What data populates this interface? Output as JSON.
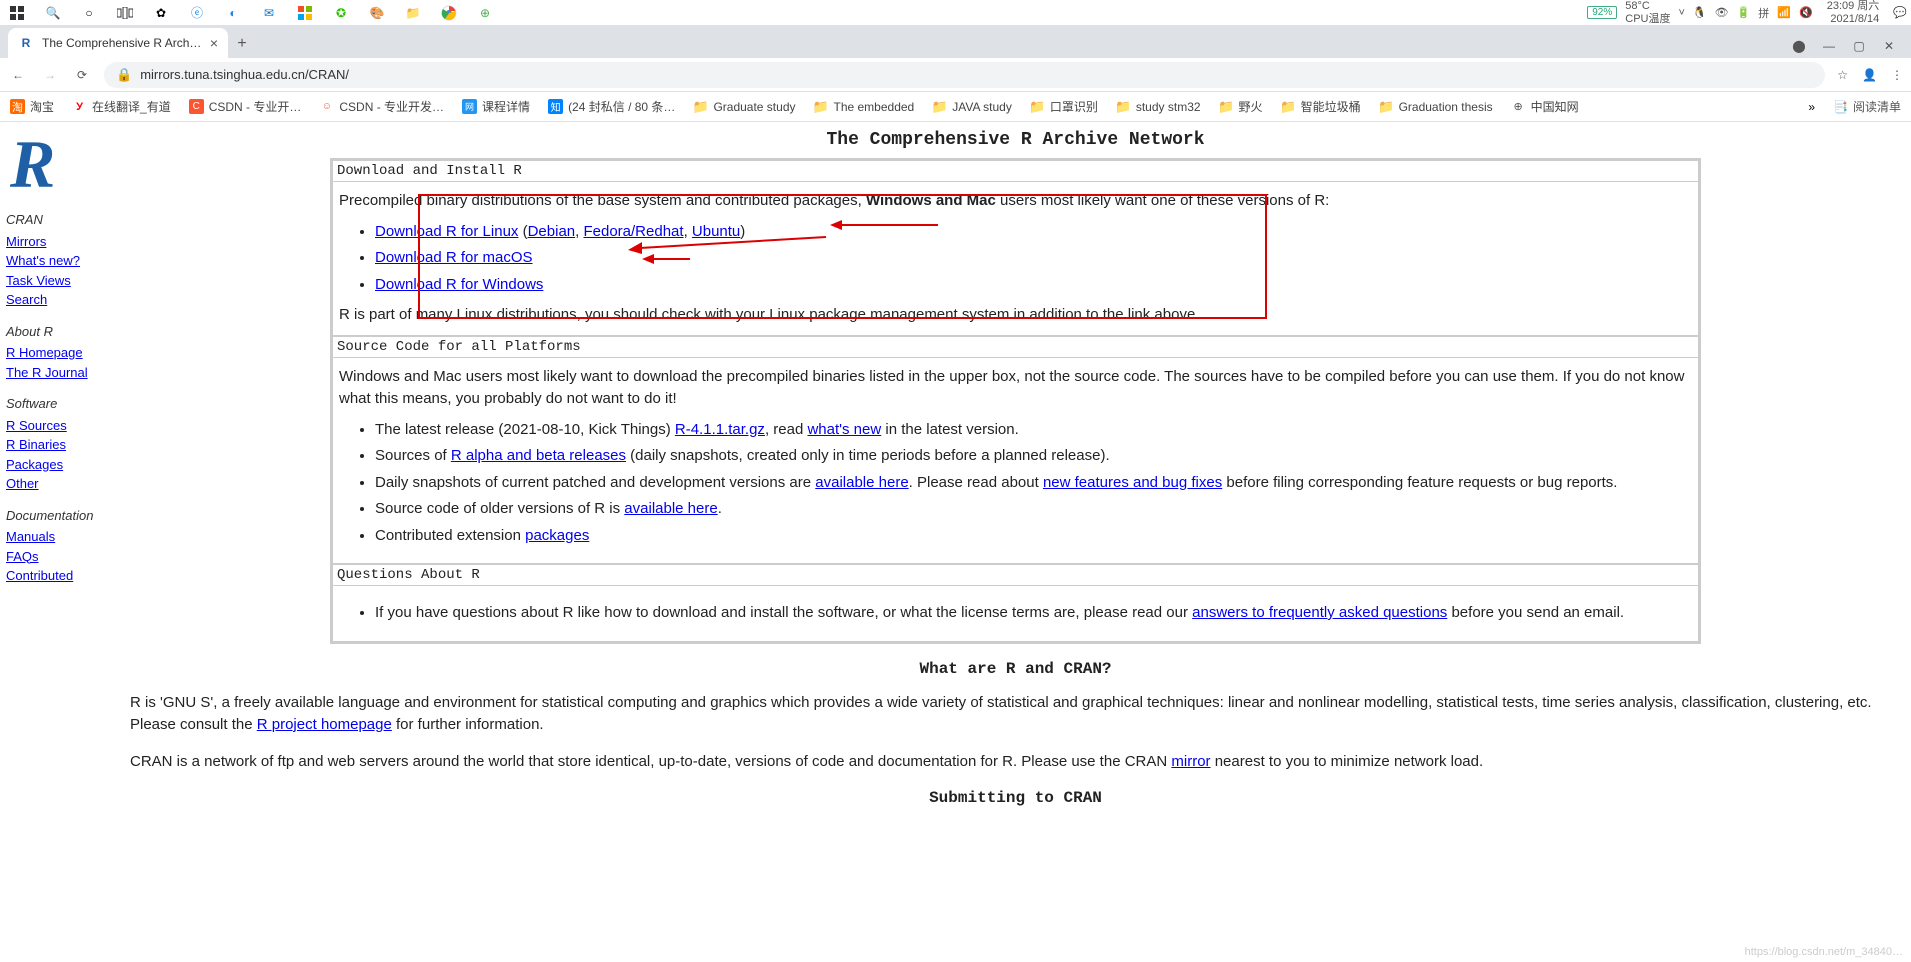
{
  "taskbar": {
    "battery_percent": "92%",
    "cpu_temp": "58°C",
    "cpu_label": "CPU温度",
    "time": "23:09",
    "day": "周六",
    "date": "2021/8/14"
  },
  "browser": {
    "tab_title": "The Comprehensive R Archive…",
    "new_tab": "+",
    "url": "mirrors.tuna.tsinghua.edu.cn/CRAN/",
    "account_icon": "👤",
    "menu_icon": "⋮",
    "star_icon": "☆"
  },
  "bookmarks": {
    "items": [
      {
        "label": "淘宝",
        "icon_class": "bm-taobao",
        "icon": "淘"
      },
      {
        "label": "在线翻译_有道",
        "icon_class": "bm-youdao",
        "icon": "У"
      },
      {
        "label": "CSDN - 专业开…",
        "icon_class": "bm-csdn",
        "icon": "C"
      },
      {
        "label": "CSDN - 专业开发…",
        "icon_class": "bm-csdn2",
        "icon": "☺"
      },
      {
        "label": "课程详情",
        "icon_class": "bm-mooc",
        "icon": "网"
      },
      {
        "label": "(24 封私信 / 80 条…",
        "icon_class": "bm-zhihu",
        "icon": "知"
      },
      {
        "label": "Graduate study",
        "icon_class": "bm-folder",
        "icon": "📁"
      },
      {
        "label": "The embedded",
        "icon_class": "bm-folder",
        "icon": "📁"
      },
      {
        "label": "JAVA study",
        "icon_class": "bm-folder",
        "icon": "📁"
      },
      {
        "label": "口罩识别",
        "icon_class": "bm-folder",
        "icon": "📁"
      },
      {
        "label": "study stm32",
        "icon_class": "bm-folder",
        "icon": "📁"
      },
      {
        "label": "野火",
        "icon_class": "bm-folder",
        "icon": "📁"
      },
      {
        "label": "智能垃圾桶",
        "icon_class": "bm-folder",
        "icon": "📁"
      },
      {
        "label": "Graduation thesis",
        "icon_class": "bm-folder",
        "icon": "📁"
      },
      {
        "label": "中国知网",
        "icon_class": "bm-cnki",
        "icon": "⊕"
      }
    ],
    "more": "»",
    "reading_list": "阅读清单"
  },
  "sidebar": {
    "logo": "R",
    "groups": [
      {
        "heading": "CRAN",
        "links": [
          "Mirrors",
          "What's new?",
          "Task Views",
          "Search"
        ]
      },
      {
        "heading": "About R",
        "links": [
          "R Homepage",
          "The R Journal"
        ]
      },
      {
        "heading": "Software",
        "links": [
          "R Sources",
          "R Binaries",
          "Packages",
          "Other"
        ]
      },
      {
        "heading": "Documentation",
        "links": [
          "Manuals",
          "FAQs",
          "Contributed"
        ]
      }
    ]
  },
  "page": {
    "title": "The Comprehensive R Archive Network",
    "section1": {
      "header": "Download and Install R",
      "intro_prefix": "Precompiled binary distributions of the base system and contributed packages, ",
      "intro_bold": "Windows and Mac",
      "intro_suffix": " users most likely want one of these versions of R:",
      "links": {
        "linux": "Download R for Linux",
        "debian": "Debian",
        "fedora": "Fedora/Redhat",
        "ubuntu": "Ubuntu",
        "macos": "Download R for macOS",
        "windows": "Download R for Windows"
      },
      "footer": "R is part of many Linux distributions, you should check with your Linux package management system in addition to the link above."
    },
    "section2": {
      "header": "Source Code for all Platforms",
      "intro": "Windows and Mac users most likely want to download the precompiled binaries listed in the upper box, not the source code. The sources have to be compiled before you can use them. If you do not know what this means, you probably do not want to do it!",
      "items": {
        "i1_prefix": "The latest release (2021-08-10, Kick Things) ",
        "i1_link": "R-4.1.1.tar.gz",
        "i1_mid": ", read ",
        "i1_link2": "what's new",
        "i1_suffix": " in the latest version.",
        "i2_prefix": "Sources of ",
        "i2_link": "R alpha and beta releases",
        "i2_suffix": " (daily snapshots, created only in time periods before a planned release).",
        "i3_prefix": "Daily snapshots of current patched and development versions are ",
        "i3_link": "available here",
        "i3_mid": ". Please read about ",
        "i3_link2": "new features and bug fixes",
        "i3_suffix": " before filing corresponding feature requests or bug reports.",
        "i4_prefix": "Source code of older versions of R is ",
        "i4_link": "available here",
        "i4_suffix": ".",
        "i5_prefix": "Contributed extension ",
        "i5_link": "packages"
      }
    },
    "section3": {
      "header": "Questions About R",
      "text_prefix": "If you have questions about R like how to download and install the software, or what the license terms are, please read our ",
      "faq_link": "answers to frequently asked questions",
      "text_suffix": " before you send an email."
    },
    "sub1_title": "What are R and CRAN?",
    "para1_prefix": "R is 'GNU S', a freely available language and environment for statistical computing and graphics which provides a wide variety of statistical and graphical techniques: linear and nonlinear modelling, statistical tests, time series analysis, classification, clustering, etc. Please consult the ",
    "para1_link": "R project homepage",
    "para1_suffix": " for further information.",
    "para2_prefix": "CRAN is a network of ftp and web servers around the world that store identical, up-to-date, versions of code and documentation for R. Please use the CRAN ",
    "para2_link": "mirror",
    "para2_suffix": " nearest to you to minimize network load.",
    "sub2_title": "Submitting to CRAN"
  },
  "watermark": "https://blog.csdn.net/m_34840…"
}
